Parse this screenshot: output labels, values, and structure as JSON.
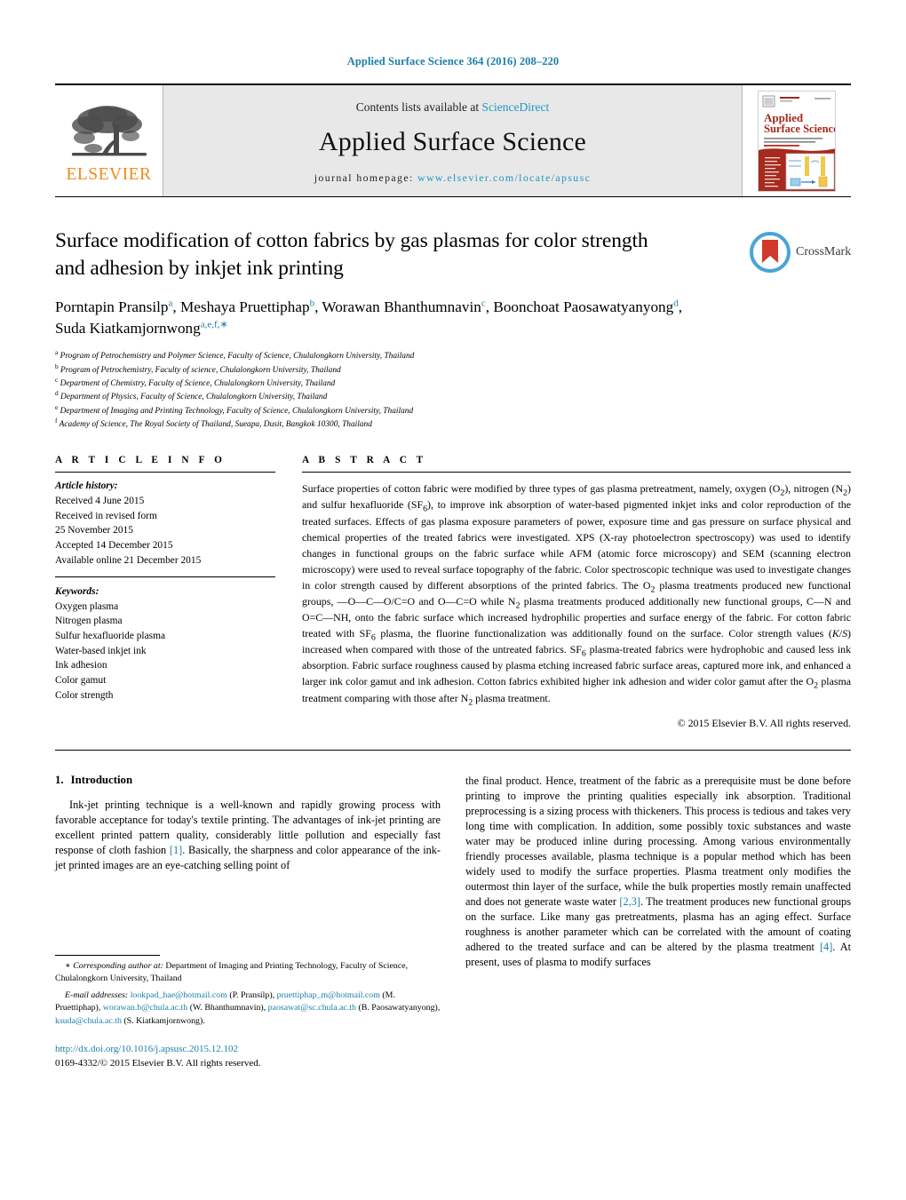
{
  "running_head": "Applied Surface Science 364 (2016) 208–220",
  "masthead": {
    "contents_prefix": "Contents lists available at ",
    "sciencedirect": "ScienceDirect",
    "journal_name": "Applied Surface Science",
    "homepage_prefix": "journal homepage: ",
    "homepage_url": "www.elsevier.com/locate/apsusc",
    "publisher_wordmark": "ELSEVIER",
    "cover_title_line1": "Applied",
    "cover_title_line2": "Surface Science",
    "accent_blue": "#2196c4",
    "elsevier_orange": "#f08a1c"
  },
  "crossmark": {
    "label": "CrossMark"
  },
  "article": {
    "title": "Surface modification of cotton fabrics by gas plasmas for color strength and adhesion by inkjet ink printing",
    "authors_html": "Porntapin Pransilp<sup>a</sup>, Meshaya Pruettiphap<sup>b</sup>, Worawan Bhanthumnavin<sup>c</sup>, Boonchoat Paosawatyanyong<sup>d</sup>, Suda Kiatkamjornwong<sup>a,e,f,</sup><sup class=\"star\">∗</sup>",
    "affiliations": [
      {
        "marker": "a",
        "text": "Program of Petrochemistry and Polymer Science, Faculty of Science, Chulalongkorn University, Thailand"
      },
      {
        "marker": "b",
        "text": "Program of Petrochemistry, Faculty of science, Chulalongkorn University, Thailand"
      },
      {
        "marker": "c",
        "text": "Department of Chemistry, Faculty of Science, Chulalongkorn University, Thailand"
      },
      {
        "marker": "d",
        "text": "Department of Physics, Faculty of Science, Chulalongkorn University, Thailand"
      },
      {
        "marker": "e",
        "text": "Department of Imaging and Printing Technology, Faculty of Science, Chulalongkorn University, Thailand"
      },
      {
        "marker": "f",
        "text": "Academy of Science, The Royal Society of Thailand, Sueapa, Dusit, Bangkok 10300, Thailand"
      }
    ]
  },
  "article_info": {
    "heading": "A R T I C L E   I N F O",
    "history_label": "Article history:",
    "history": [
      "Received 4 June 2015",
      "Received in revised form",
      "25 November 2015",
      "Accepted 14 December 2015",
      "Available online 21 December 2015"
    ],
    "keywords_label": "Keywords:",
    "keywords": [
      "Oxygen plasma",
      "Nitrogen plasma",
      "Sulfur hexafluoride plasma",
      "Water-based inkjet ink",
      "Ink adhesion",
      "Color gamut",
      "Color strength"
    ]
  },
  "abstract": {
    "heading": "A B S T R A C T",
    "text_html": "Surface properties of cotton fabric were modified by three types of gas plasma pretreatment, namely, oxygen (O<sub>2</sub>), nitrogen (N<sub>2</sub>) and sulfur hexafluoride (SF<sub>6</sub>), to improve ink absorption of water-based pigmented inkjet inks and color reproduction of the treated surfaces. Effects of gas plasma exposure parameters of power, exposure time and gas pressure on surface physical and chemical properties of the treated fabrics were investigated. XPS (X-ray photoelectron spectroscopy) was used to identify changes in functional groups on the fabric surface while AFM (atomic force microscopy) and SEM (scanning electron microscopy) were used to reveal surface topography of the fabric. Color spectroscopic technique was used to investigate changes in color strength caused by different absorptions of the printed fabrics. The O<sub>2</sub> plasma treatments produced new functional groups, —O—C—O/C=O and O—C=O while N<sub>2</sub> plasma treatments produced additionally new functional groups, C—N and O=C—NH, onto the fabric surface which increased hydrophilic properties and surface energy of the fabric. For cotton fabric treated with SF<sub>6</sub> plasma, the fluorine functionalization was additionally found on the surface. Color strength values (<i>K</i>/<i>S</i>) increased when compared with those of the untreated fabrics. SF<sub>6</sub> plasma-treated fabrics were hydrophobic and caused less ink absorption. Fabric surface roughness caused by plasma etching increased fabric surface areas, captured more ink, and enhanced a larger ink color gamut and ink adhesion. Cotton fabrics exhibited higher ink adhesion and wider color gamut after the O<sub>2</sub> plasma treatment comparing with those after N<sub>2</sub> plasma treatment.",
    "copyright": "© 2015 Elsevier B.V. All rights reserved."
  },
  "body": {
    "section_number": "1.",
    "section_title": "Introduction",
    "left_paragraph_html": "Ink-jet printing technique is a well-known and rapidly growing process with favorable acceptance for today's textile printing. The advantages of ink-jet printing are excellent printed pattern quality, considerably little pollution and especially fast response of cloth fashion <span class=\"ref\">[1]</span>. Basically, the sharpness and color appearance of the ink-jet printed images are an eye-catching selling point of",
    "right_paragraph_html": "the final product. Hence, treatment of the fabric as a prerequisite must be done before printing to improve the printing qualities especially ink absorption. Traditional preprocessing is a sizing process with thickeners. This process is tedious and takes very long time with complication. In addition, some possibly toxic substances and waste water may be produced inline during processing. Among various environmentally friendly processes available, plasma technique is a popular method which has been widely used to modify the surface properties. Plasma treatment only modifies the outermost thin layer of the surface, while the bulk properties mostly remain unaffected and does not generate waste water <span class=\"ref\">[2,3]</span>. The treatment produces new functional groups on the surface. Like many gas pretreatments, plasma has an aging effect. Surface roughness is another parameter which can be correlated with the amount of coating adhered to the treated surface and can be altered by the plasma treatment <span class=\"ref\">[4]</span>. At present, uses of plasma to modify surfaces"
  },
  "footnote": {
    "corresponding_html": "<span class=\"ind\">∗ <i>Corresponding author at:</i> Department of Imaging and Printing Technology, Faculty of Science, Chulalongkorn University, Thailand</span>",
    "emails_html": "<span class=\"ind\"><i>E-mail addresses:</i> <span class=\"link\">lookpad_hae@hotmail.com</span> (P. Pransilp), <span class=\"link\">pruettiphap_m@hotmail.com</span> (M. Pruettiphap), <span class=\"link\">worawan.b@chula.ac.th</span> (W. Bhanthumnavin), <span class=\"link\">paosawat@sc.chula.ac.th</span> (B. Paosawatyanyong), <span class=\"link\">ksuda@chula.ac.th</span> (S. Kiatkamjornwong).</span>",
    "doi_url": "http://dx.doi.org/10.1016/j.apsusc.2015.12.102",
    "issn_line": "0169-4332/© 2015 Elsevier B.V. All rights reserved."
  }
}
